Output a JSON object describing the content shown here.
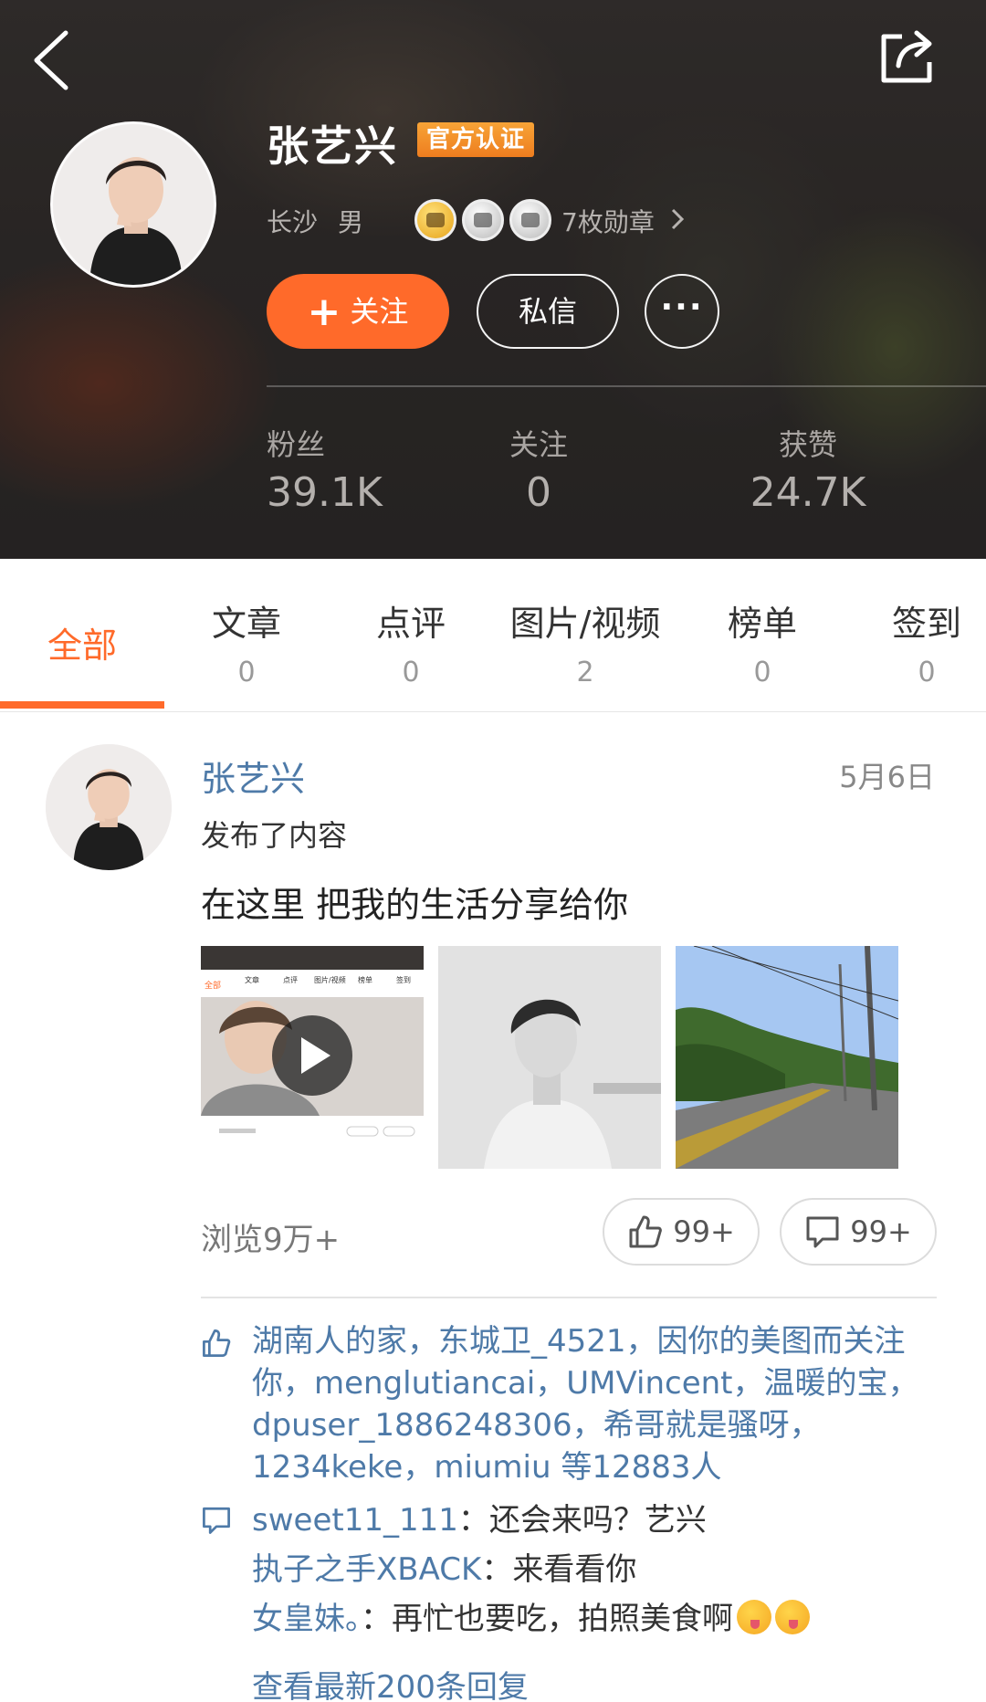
{
  "header": {
    "name": "张艺兴",
    "badge": "官方认证",
    "location": "长沙",
    "gender": "男",
    "medal_count": "7枚勋章",
    "follow_label": "关注",
    "message_label": "私信",
    "more_label": "···",
    "stats": [
      {
        "label": "粉丝",
        "value": "39.1K"
      },
      {
        "label": "关注",
        "value": "0"
      },
      {
        "label": "获赞",
        "value": "24.7K"
      }
    ]
  },
  "tabs": [
    {
      "label": "全部"
    },
    {
      "label": "文章",
      "count": "0"
    },
    {
      "label": "点评",
      "count": "0"
    },
    {
      "label": "图片/视频",
      "count": "2"
    },
    {
      "label": "榜单",
      "count": "0"
    },
    {
      "label": "签到",
      "count": "0"
    }
  ],
  "post": {
    "author": "张艺兴",
    "date": "5月6日",
    "action": "发布了内容",
    "text": "在这里 把我的生活分享给你",
    "views": "浏览9万+",
    "likes": "99+",
    "comments": "99+",
    "likers": "湖南人的家，东城卫_4521，因你的美图而关注你，menglutiancai，UMVincent，温暖的宝，dpuser_1886248306，希哥就是骚呀，1234keke，miumiu 等12883人",
    "replies": [
      {
        "user": "sweet11_111",
        "sep": "：",
        "content": "还会来吗？艺兴"
      },
      {
        "user": "执子之手XBACK",
        "sep": "：",
        "content": "来看看你"
      },
      {
        "user": "女皇妹。",
        "sep": "：",
        "content": "再忙也要吃，拍照美食啊"
      }
    ],
    "more_replies": "查看最新200条回复"
  },
  "video_thumb": {
    "tabs": [
      "全部",
      "文章",
      "点评",
      "图片/视频",
      "榜单",
      "签到"
    ]
  },
  "colors": {
    "accent": "#ff6a2a",
    "link": "#4e7aa8",
    "badge": "#ee7d1f"
  }
}
